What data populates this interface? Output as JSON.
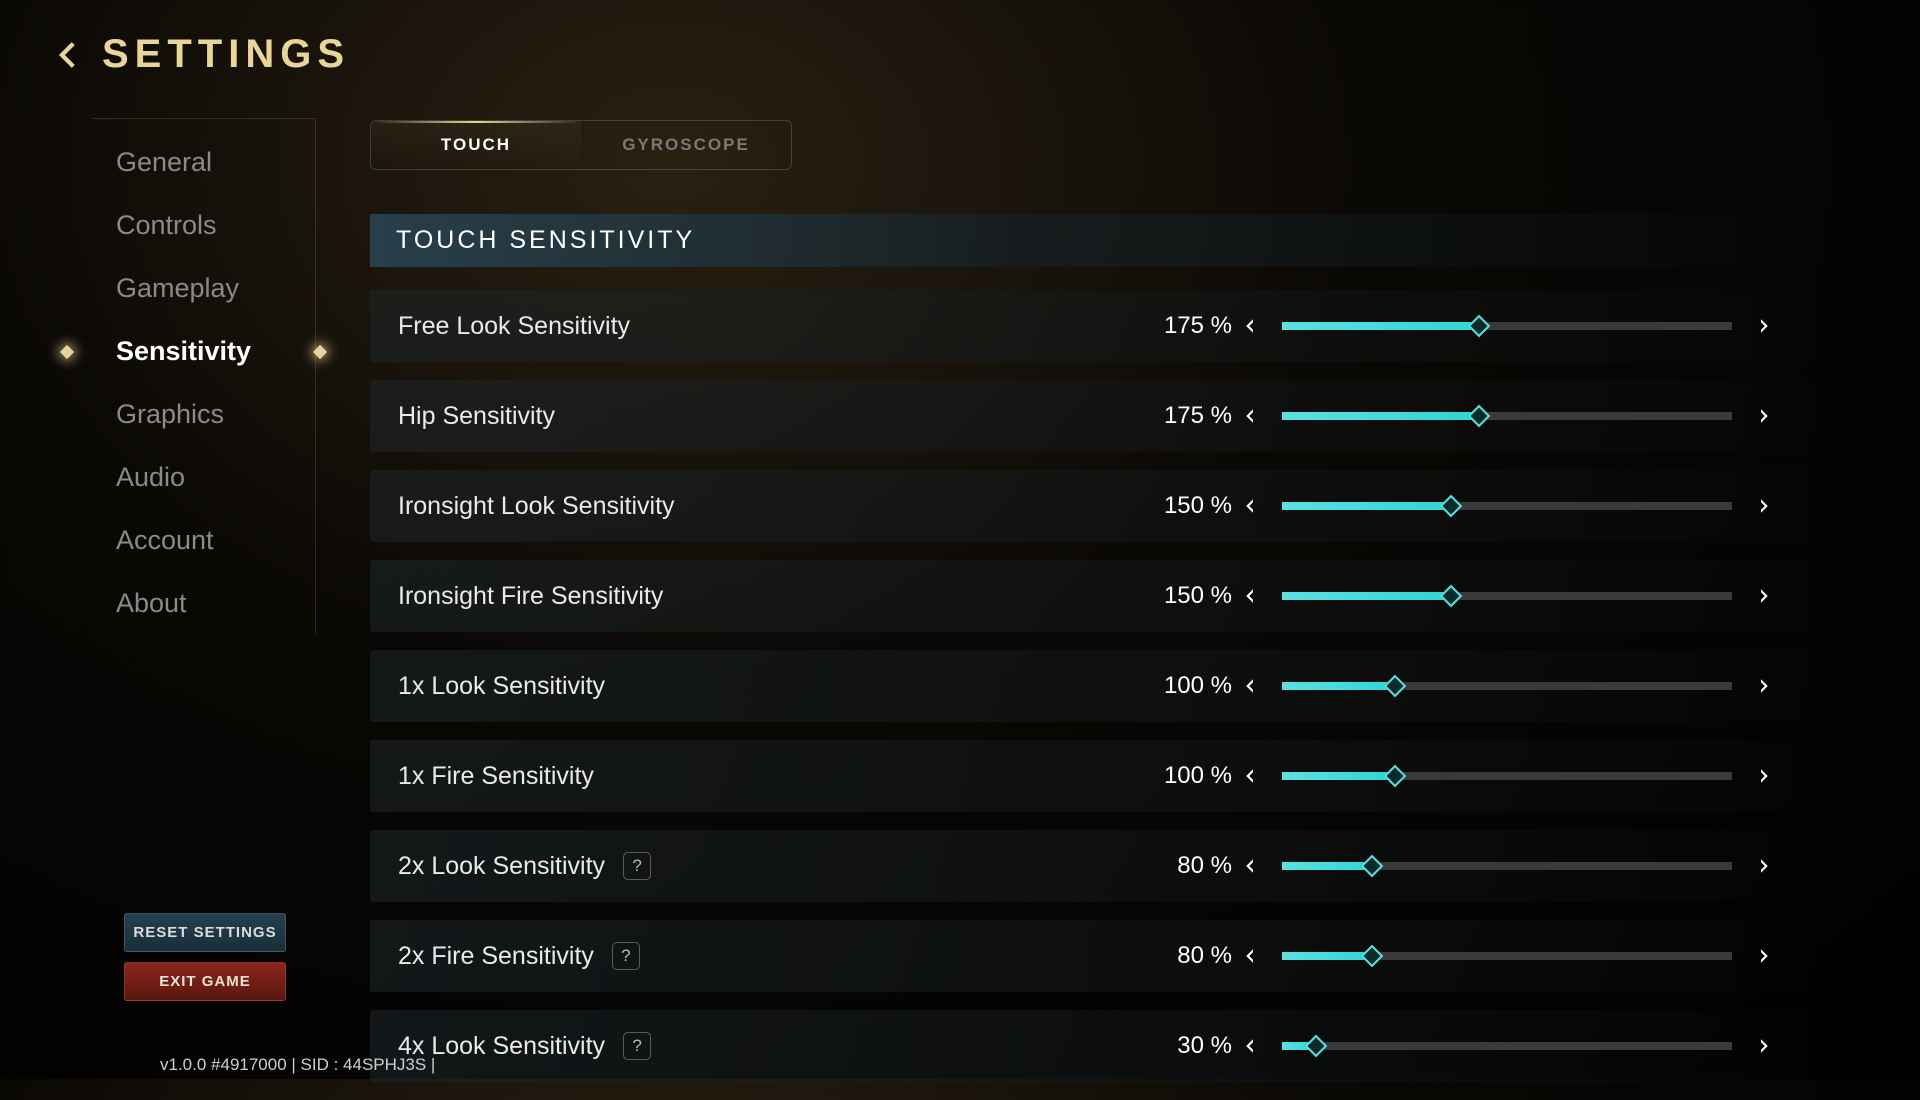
{
  "header": {
    "title": "SETTINGS"
  },
  "sidebar": {
    "items": [
      {
        "label": "General"
      },
      {
        "label": "Controls"
      },
      {
        "label": "Gameplay"
      },
      {
        "label": "Sensitivity",
        "active": true
      },
      {
        "label": "Graphics"
      },
      {
        "label": "Audio"
      },
      {
        "label": "Account"
      },
      {
        "label": "About"
      }
    ]
  },
  "tabs": [
    {
      "label": "TOUCH",
      "active": true
    },
    {
      "label": "GYROSCOPE",
      "active": false
    }
  ],
  "section": {
    "title": "TOUCH SENSITIVITY"
  },
  "sliders": [
    {
      "label": "Free Look Sensitivity",
      "value": 175,
      "display": "175 %",
      "help": false,
      "max": 400
    },
    {
      "label": "Hip Sensitivity",
      "value": 175,
      "display": "175 %",
      "help": false,
      "max": 400
    },
    {
      "label": "Ironsight Look Sensitivity",
      "value": 150,
      "display": "150 %",
      "help": false,
      "max": 400
    },
    {
      "label": "Ironsight Fire Sensitivity",
      "value": 150,
      "display": "150 %",
      "help": false,
      "max": 400
    },
    {
      "label": "1x Look Sensitivity",
      "value": 100,
      "display": "100 %",
      "help": false,
      "max": 400
    },
    {
      "label": "1x Fire Sensitivity",
      "value": 100,
      "display": "100 %",
      "help": false,
      "max": 400
    },
    {
      "label": "2x Look Sensitivity",
      "value": 80,
      "display": "80 %",
      "help": true,
      "max": 400
    },
    {
      "label": "2x Fire Sensitivity",
      "value": 80,
      "display": "80 %",
      "help": true,
      "max": 400
    },
    {
      "label": "4x Look Sensitivity",
      "value": 30,
      "display": "30 %",
      "help": true,
      "max": 400
    }
  ],
  "buttons": {
    "reset": "RESET SETTINGS",
    "exit": "EXIT GAME"
  },
  "footer": "v1.0.0 #4917000  |  SID : 44SPHJ3S  |",
  "help_glyph": "?"
}
